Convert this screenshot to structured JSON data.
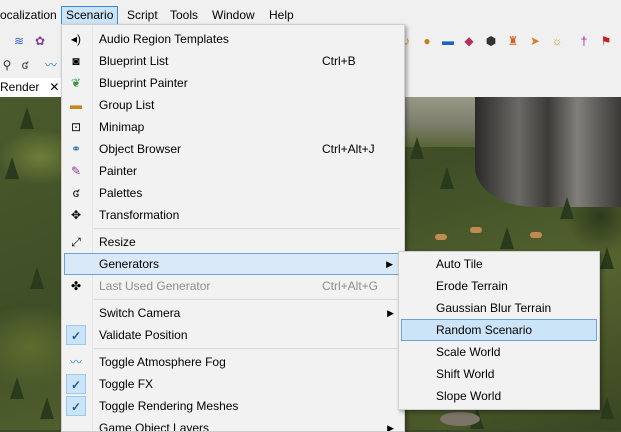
{
  "menubar": {
    "items": [
      "ocalization",
      "Scenario",
      "Script",
      "Tools",
      "Window",
      "Help"
    ]
  },
  "tab": {
    "label": "Render",
    "close": "✕"
  },
  "scenario_menu": {
    "items": [
      {
        "label": "Audio Region Templates",
        "icon": "speaker-icon",
        "glyph": "◂)",
        "shortcut": ""
      },
      {
        "label": "Blueprint List",
        "icon": "blueprint-icon",
        "glyph": "◙",
        "shortcut": "Ctrl+B"
      },
      {
        "label": "Blueprint Painter",
        "icon": "leaf-icon",
        "glyph": "❦",
        "shortcut": ""
      },
      {
        "label": "Group List",
        "icon": "group-icon",
        "glyph": "▬",
        "shortcut": ""
      },
      {
        "label": "Minimap",
        "icon": "minimap-icon",
        "glyph": "⊡",
        "shortcut": ""
      },
      {
        "label": "Object Browser",
        "icon": "binoculars-icon",
        "glyph": "⚭",
        "shortcut": "Ctrl+Alt+J"
      },
      {
        "label": "Painter",
        "icon": "paintbrush-icon",
        "glyph": "✎",
        "shortcut": ""
      },
      {
        "label": "Palettes",
        "icon": "palette-icon",
        "glyph": "ʛ",
        "shortcut": ""
      },
      {
        "label": "Transformation",
        "icon": "move-icon",
        "glyph": "✥",
        "shortcut": ""
      },
      {
        "label": "Resize",
        "icon": "resize-icon",
        "glyph": "⤢",
        "shortcut": ""
      },
      {
        "label": "Generators",
        "icon": "",
        "glyph": "",
        "shortcut": ""
      },
      {
        "label": "Last Used Generator",
        "icon": "generator-icon",
        "glyph": "✤",
        "shortcut": "Ctrl+Alt+G"
      },
      {
        "label": "Switch Camera",
        "icon": "",
        "glyph": "",
        "shortcut": ""
      },
      {
        "label": "Validate Position",
        "icon": "check-icon",
        "glyph": "✓",
        "shortcut": ""
      },
      {
        "label": "Toggle Atmosphere Fog",
        "icon": "fog-icon",
        "glyph": "〰",
        "shortcut": ""
      },
      {
        "label": "Toggle FX",
        "icon": "check-icon",
        "glyph": "✓",
        "shortcut": ""
      },
      {
        "label": "Toggle Rendering Meshes",
        "icon": "check-icon",
        "glyph": "✓",
        "shortcut": ""
      },
      {
        "label": "Game Object Layers",
        "icon": "",
        "glyph": "",
        "shortcut": ""
      }
    ]
  },
  "generators_submenu": {
    "items": [
      "Auto Tile",
      "Erode Terrain",
      "Gaussian Blur Terrain",
      "Random Scenario",
      "Scale World",
      "Shift World",
      "Slope World"
    ]
  }
}
